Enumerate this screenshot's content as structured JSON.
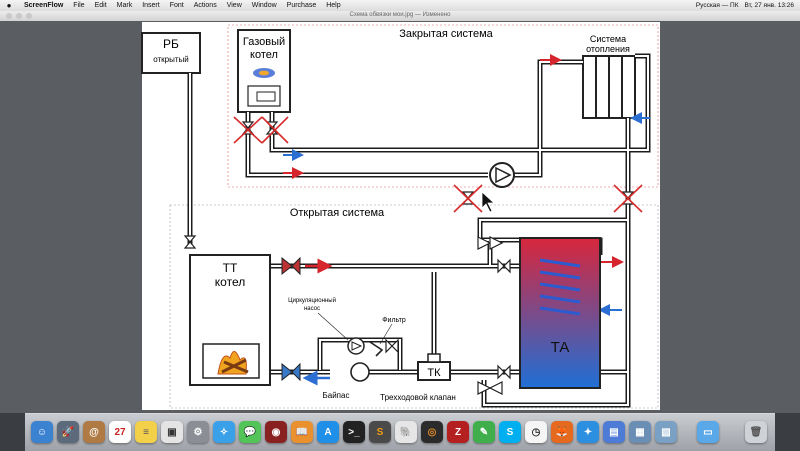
{
  "menubar": {
    "app_name": "ScreenFlow",
    "items": [
      "File",
      "Edit",
      "Mark",
      "Insert",
      "Font",
      "Actions",
      "View",
      "Window",
      "Purchase",
      "Help"
    ],
    "status": {
      "input": "Русская — ПК",
      "datetime": "Вт, 27 янв. 13:26"
    }
  },
  "window": {
    "title": "Схема обвязки мои.jpg — Изменено"
  },
  "diagram": {
    "rb_title": "РБ",
    "rb_subtitle": "открытый",
    "gas_boiler": "Газовый котел",
    "closed_system": "Закрытая система",
    "heating_system": "Система отопления",
    "open_system": "Открытая система",
    "tt_boiler": "ТТ котел",
    "circ_pump": "Циркуляционный насос",
    "filter": "Фильтр",
    "tk": "ТК",
    "bypass": "Байпас",
    "three_way_valve": "Трехходовой клапан",
    "ta": "ТА"
  },
  "dock": {
    "calendar_day": "27",
    "icons": [
      "finder-icon",
      "launchpad-icon",
      "contacts-icon",
      "calendar-icon",
      "notes-icon",
      "preview-icon",
      "system-preferences-icon",
      "safari-icon",
      "messages-icon",
      "photo-booth-icon",
      "ibooks-icon",
      "app-store-icon",
      "terminal-icon",
      "sublime-icon",
      "mamp-icon",
      "speakers-icon",
      "filezilla-icon",
      "evernote-icon",
      "skype-icon",
      "clock-icon",
      "firefox-icon",
      "safari-alt-icon",
      "dictionary-icon",
      "preview-alt-icon",
      "image-capture-icon",
      "folder-icon",
      "trash-icon"
    ]
  },
  "colors": {
    "hot": "#d6262d",
    "cold": "#2a6fd1",
    "ta_top": "#d8263c",
    "ta_bottom": "#1f6fd6",
    "pipe": "#1c1c1c"
  }
}
